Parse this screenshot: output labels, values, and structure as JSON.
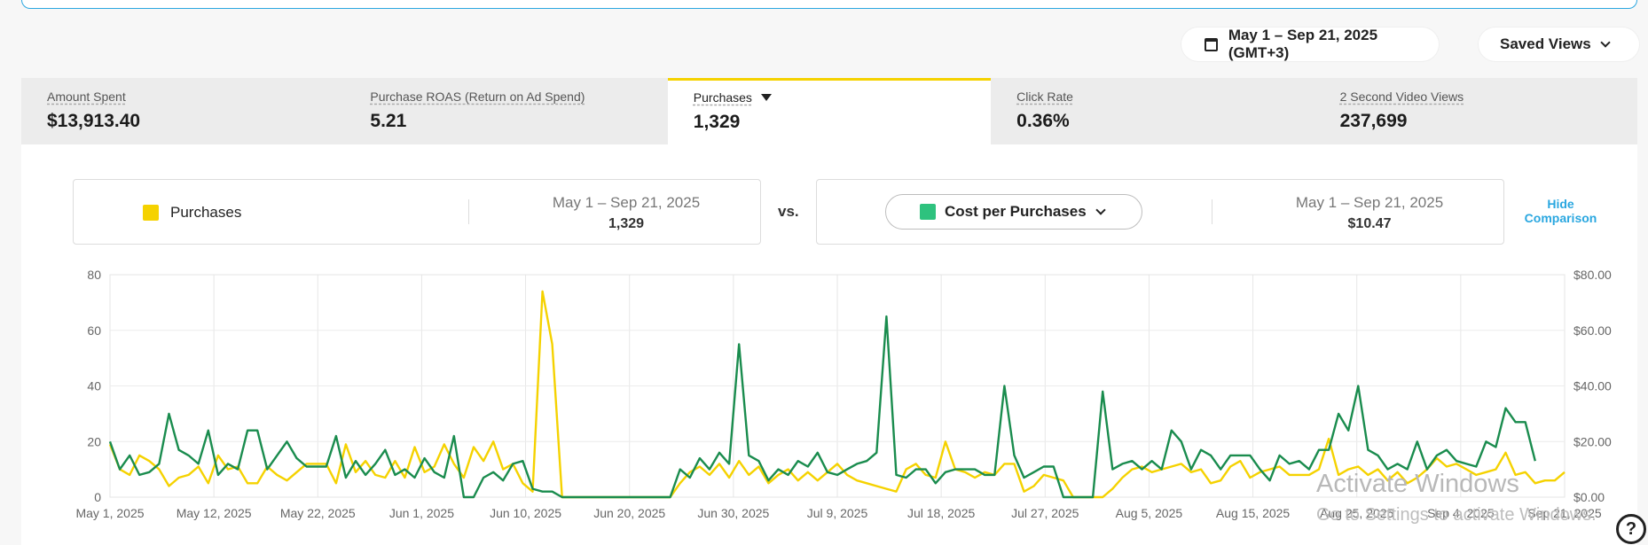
{
  "toolbar": {
    "date_range": "May 1 – Sep 21, 2025 (GMT+3)",
    "saved_views": "Saved Views"
  },
  "metrics": [
    {
      "label": "Amount Spent",
      "value": "$13,913.40"
    },
    {
      "label": "Purchase ROAS (Return on Ad Spend)",
      "value": "5.21"
    },
    {
      "label": "Purchases",
      "value": "1,329"
    },
    {
      "label": "Click Rate",
      "value": "0.36%"
    },
    {
      "label": "2 Second Video Views",
      "value": "237,699"
    }
  ],
  "comparison": {
    "primary_label": "Purchases",
    "primary_range": "May 1 – Sep 21, 2025",
    "primary_value": "1,329",
    "vs": "vs.",
    "secondary_label": "Cost per Purchases",
    "secondary_range": "May 1 – Sep 21, 2025",
    "secondary_value": "$10.47",
    "hide_label_line1": "Hide",
    "hide_label_line2": "Comparison"
  },
  "watermark": {
    "title": "Activate Windows",
    "subtitle": "Go to Settings to activate Windows."
  },
  "help_icon": "?",
  "chart_data": {
    "type": "line",
    "x_tick_labels": [
      "May 1, 2025",
      "May 12, 2025",
      "May 22, 2025",
      "Jun 1, 2025",
      "Jun 10, 2025",
      "Jun 20, 2025",
      "Jun 30, 2025",
      "Jul 9, 2025",
      "Jul 18, 2025",
      "Jul 27, 2025",
      "Aug 5, 2025",
      "Aug 15, 2025",
      "Aug 25, 2025",
      "Sep 4, 2025",
      "Sep 21, 2025"
    ],
    "y_left_ticks": [
      "0",
      "20",
      "40",
      "60",
      "80"
    ],
    "y_right_ticks": [
      "$0.00",
      "$20.00",
      "$40.00",
      "$60.00",
      "$80.00"
    ],
    "y_left_range": [
      0,
      80
    ],
    "y_right_range": [
      0,
      80
    ],
    "grid": true,
    "colors": {
      "purchases": "#f5d200",
      "cost": "#1a8c4e"
    },
    "series": [
      {
        "name": "Purchases",
        "axis": "left",
        "values": [
          19,
          10,
          8,
          15,
          13,
          10,
          4,
          7,
          8,
          11,
          5,
          15,
          10,
          11,
          5,
          5,
          11,
          8,
          6,
          9,
          12,
          12,
          12,
          5,
          19,
          9,
          13,
          8,
          7,
          13,
          7,
          18,
          9,
          11,
          19,
          12,
          7,
          18,
          13,
          20,
          10,
          12,
          5,
          2,
          74,
          55,
          0,
          0,
          0,
          0,
          0,
          0,
          0,
          0,
          0,
          0,
          0,
          0,
          5,
          9,
          11,
          8,
          12,
          7,
          13,
          8,
          11,
          5,
          8,
          10,
          6,
          9,
          6,
          9,
          12,
          8,
          6,
          5,
          4,
          3,
          2,
          10,
          12,
          8,
          7,
          20,
          10,
          9,
          7,
          9,
          8,
          12,
          12,
          2,
          4,
          8,
          7,
          6,
          0,
          0,
          0,
          0,
          3,
          7,
          10,
          11,
          9,
          10,
          11,
          12,
          9,
          10,
          5,
          6,
          11,
          13,
          7,
          9,
          10,
          11,
          8,
          8,
          8,
          10,
          21,
          8,
          10,
          11,
          8,
          10,
          6,
          9,
          5,
          7,
          10,
          14,
          11,
          12,
          10,
          8,
          9,
          10,
          16,
          8,
          9,
          5,
          6,
          6,
          9
        ]
      },
      {
        "name": "Cost per Purchases",
        "axis": "right",
        "values": [
          20,
          10,
          15,
          8,
          9,
          12,
          30,
          17,
          15,
          12,
          24,
          8,
          12,
          10,
          24,
          24,
          10,
          15,
          20,
          14,
          11,
          11,
          11,
          22,
          7,
          13,
          8,
          12,
          17,
          8,
          10,
          7,
          14,
          9,
          7,
          22,
          0,
          0,
          7,
          9,
          6,
          12,
          13,
          3,
          2,
          2,
          0,
          0,
          0,
          0,
          0,
          0,
          0,
          0,
          0,
          0,
          0,
          0,
          10,
          7,
          14,
          10,
          16,
          12,
          55,
          15,
          13,
          6,
          10,
          8,
          13,
          11,
          16,
          9,
          8,
          10,
          12,
          13,
          16,
          65,
          8,
          7,
          10,
          10,
          5,
          9,
          10,
          10,
          10,
          8,
          8,
          40,
          15,
          7,
          9,
          11,
          11,
          0,
          0,
          0,
          0,
          38,
          10,
          12,
          13,
          10,
          13,
          10,
          24,
          20,
          10,
          17,
          15,
          10,
          15,
          15,
          15,
          10,
          6,
          15,
          12,
          13,
          10,
          17,
          17,
          30,
          24,
          40,
          17,
          15,
          10,
          12,
          10,
          20,
          10,
          15,
          17,
          13,
          12,
          11,
          20,
          18,
          32,
          27,
          27,
          13
        ]
      }
    ]
  }
}
